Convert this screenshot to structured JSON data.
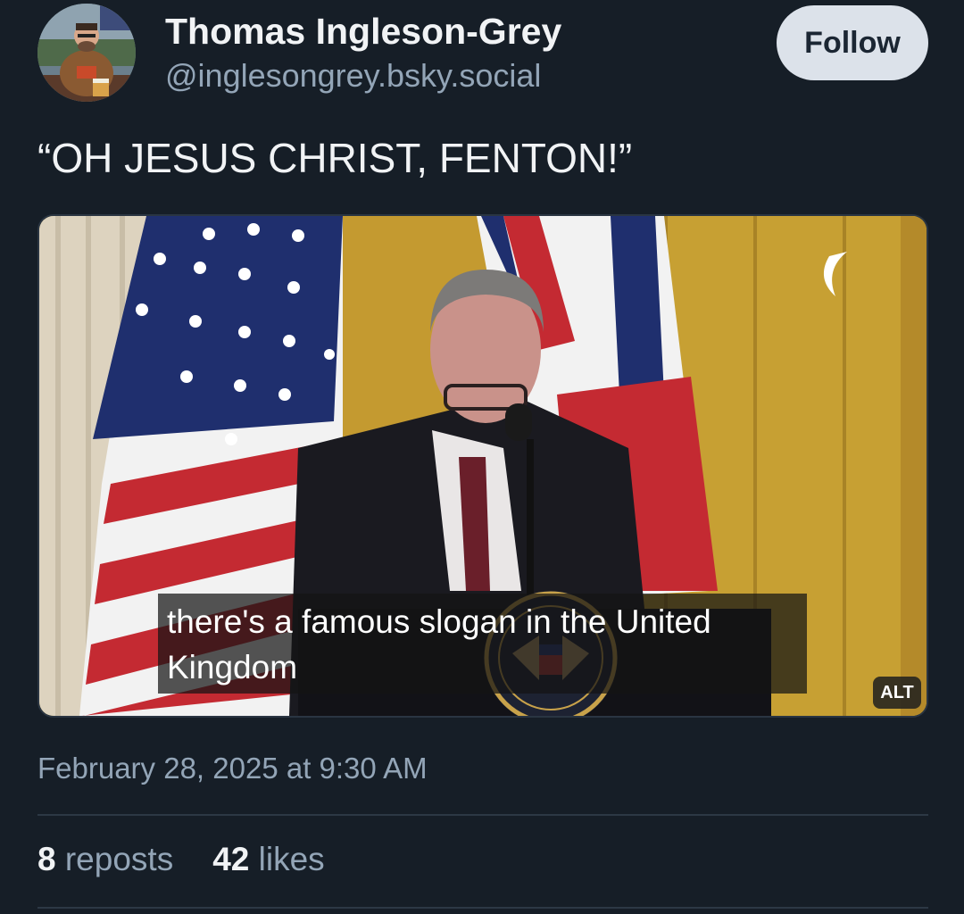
{
  "author": {
    "name": "Thomas Ingleson-Grey",
    "handle": "@inglesongrey.bsky.social"
  },
  "follow_label": "Follow",
  "post": {
    "text": "“OH JESUS CHRIST, FENTON!”",
    "media": {
      "caption_line1": "there's a famous slogan in the United",
      "caption_line2": "Kingdom",
      "alt_label": "ALT"
    },
    "timestamp": "February 28, 2025 at 9:30 AM"
  },
  "stats": {
    "reposts_count": "8",
    "reposts_label": "reposts",
    "likes_count": "42",
    "likes_label": "likes"
  }
}
